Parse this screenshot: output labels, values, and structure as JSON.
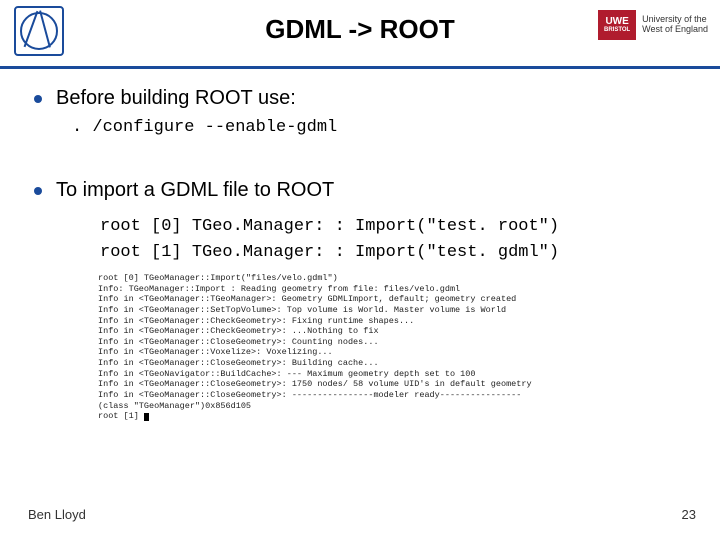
{
  "header": {
    "title": "GDML -> ROOT",
    "logo_right": {
      "badge_top": "UWE",
      "badge_bottom": "BRISTOL",
      "text_line1": "University of the",
      "text_line2": "West of England"
    }
  },
  "bullets": {
    "b1": "Before building ROOT use:",
    "b1_code": ". /configure --enable-gdml",
    "b2": "To import a GDML file to ROOT",
    "b2_code": "root [0] TGeo.Manager: : Import(\"test. root\")\nroot [1] TGeo.Manager: : Import(\"test. gdml\")"
  },
  "terminal": [
    "root [0] TGeoManager::Import(\"files/velo.gdml\")",
    "Info: TGeoManager::Import : Reading geometry from file: files/velo.gdml",
    "Info in <TGeoManager::TGeoManager>: Geometry GDMLImport, default; geometry created",
    "Info in <TGeoManager::SetTopVolume>: Top volume is World. Master volume is World",
    "Info in <TGeoManager::CheckGeometry>: Fixing runtime shapes...",
    "Info in <TGeoManager::CheckGeometry>: ...Nothing to fix",
    "Info in <TGeoManager::CloseGeometry>: Counting nodes...",
    "Info in <TGeoManager::Voxelize>: Voxelizing...",
    "Info in <TGeoManager::CloseGeometry>: Building cache...",
    "Info in <TGeoNavigator::BuildCache>: --- Maximum geometry depth set to 100",
    "Info in <TGeoManager::CloseGeometry>: 1750 nodes/ 58 volume UID's in default geometry",
    "Info in <TGeoManager::CloseGeometry>: ----------------modeler ready----------------",
    "(class \"TGeoManager\")0x856d105",
    "root [1] "
  ],
  "footer": {
    "author": "Ben Lloyd",
    "page": "23"
  }
}
